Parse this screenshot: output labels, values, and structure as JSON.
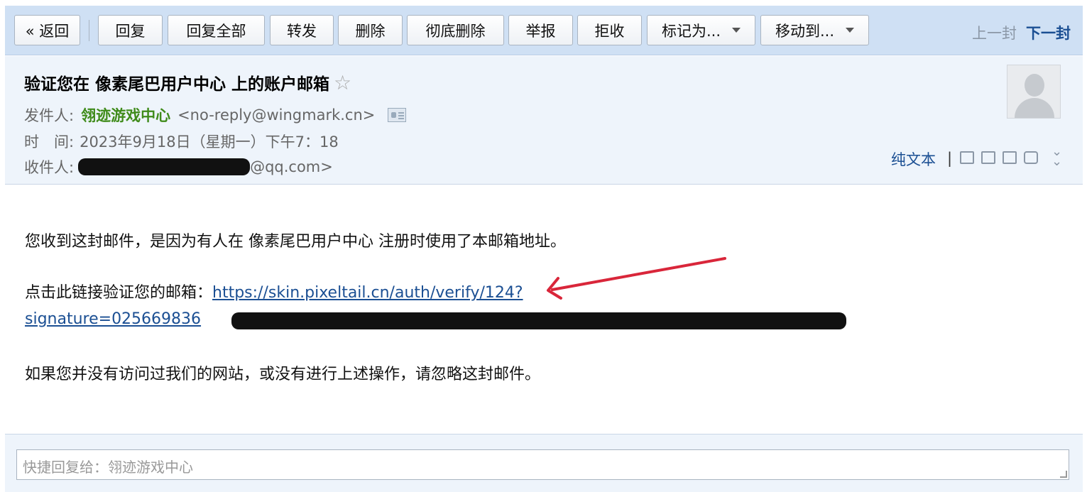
{
  "toolbar": {
    "back": "« 返回",
    "reply": "回复",
    "reply_all": "回复全部",
    "forward": "转发",
    "delete": "删除",
    "delete_forever": "彻底删除",
    "report": "举报",
    "reject": "拒收",
    "mark_as": "标记为...",
    "move_to": "移动到...",
    "prev": "上一封",
    "next": "下一封"
  },
  "header": {
    "subject": "验证您在 像素尾巴用户中心 上的账户邮箱",
    "from_label": "发件人:",
    "from_name": "翎迹游戏中心",
    "from_address": "<no-reply@wingmark.cn>",
    "time_label": "时　间:",
    "time_value": "2023年9月18日（星期一）下午7：18",
    "to_label": "收件人:",
    "to_suffix": "@qq.com>",
    "plain_text": "纯文本",
    "separator": "|"
  },
  "body": {
    "para1": "您收到这封邮件，是因为有人在 像素尾巴用户中心 注册时使用了本邮箱地址。",
    "link_prefix": "点击此链接验证您的邮箱：",
    "link_line1": "https://skin.pixeltail.cn/auth/verify/124?",
    "link_line2": "signature=025669836",
    "para3": "如果您并没有访问过我们的网站，或没有进行上述操作，请忽略这封邮件。"
  },
  "quick_reply": {
    "placeholder": "快捷回复给：翎迹游戏中心"
  },
  "colors": {
    "toolbar_bg": "#cfe0f4",
    "header_bg": "#eef4fb",
    "sender_green": "#3f8b1a",
    "link_blue": "#1b4f93",
    "annotation_arrow": "#d9263a"
  },
  "icons": [
    "star-icon",
    "vcard-icon",
    "avatar-icon",
    "new-window-icon",
    "note-icon",
    "download-icon",
    "print-icon",
    "expand-icon",
    "dropdown-caret-icon",
    "resize-grip-icon"
  ]
}
